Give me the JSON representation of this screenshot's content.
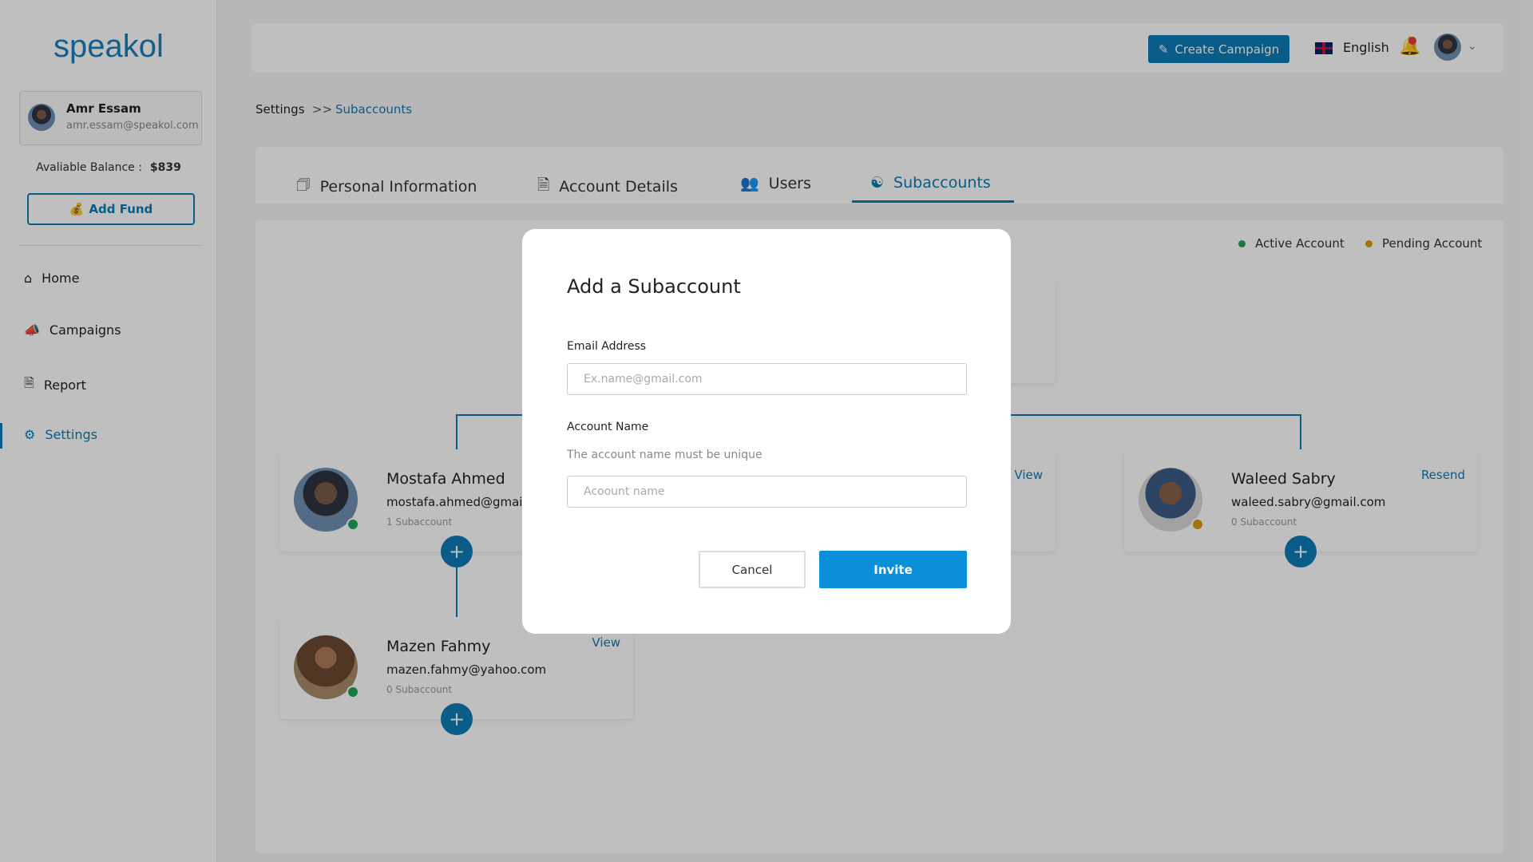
{
  "brand": {
    "logo": "speakol",
    "accent": "#0b7bb5"
  },
  "user": {
    "name": "Amr Essam",
    "email": "amr.essam@speakol.com",
    "balance_label": "Avaliable Balance :",
    "balance": "$839"
  },
  "sidebar": {
    "add_fund": "Add Fund",
    "items": [
      {
        "label": "Home",
        "icon": "home-icon"
      },
      {
        "label": "Campaigns",
        "icon": "megaphone-icon"
      },
      {
        "label": "Report",
        "icon": "report-icon"
      },
      {
        "label": "Settings",
        "icon": "gear-icon",
        "active": true
      }
    ]
  },
  "topbar": {
    "create_campaign": "Create Campaign",
    "language": "English"
  },
  "breadcrumb": {
    "root": "Settings",
    "sep": ">>",
    "current": "Subaccounts"
  },
  "tabs": [
    {
      "label": "Personal Information"
    },
    {
      "label": "Account Details"
    },
    {
      "label": "Users"
    },
    {
      "label": "Subaccounts",
      "active": true
    }
  ],
  "legend": {
    "active": "Active Account",
    "pending": "Pending Account",
    "active_color": "#22a55b",
    "pending_color": "#d89b0c"
  },
  "cards": [
    {
      "name": "Mostafa Ahmed",
      "email": "mostafa.ahmed@gmail.com",
      "subs": "1 Subaccount",
      "status": "active"
    },
    {
      "action": "View"
    },
    {
      "name": "Waleed Sabry",
      "email": "waleed.sabry@gmail.com",
      "subs": "0 Subaccount",
      "status": "pending",
      "action": "Resend"
    },
    {
      "name": "Mazen Fahmy",
      "email": "mazen.fahmy@yahoo.com",
      "subs": "0 Subaccount",
      "status": "active",
      "action": "View"
    }
  ],
  "modal": {
    "title": "Add a Subaccount",
    "email_label": "Email Address",
    "email_placeholder": "Ex.name@gmail.com",
    "name_label": "Account Name",
    "name_hint": "The account name must be unique",
    "name_placeholder": "Acoount name",
    "cancel": "Cancel",
    "invite": "Invite"
  }
}
